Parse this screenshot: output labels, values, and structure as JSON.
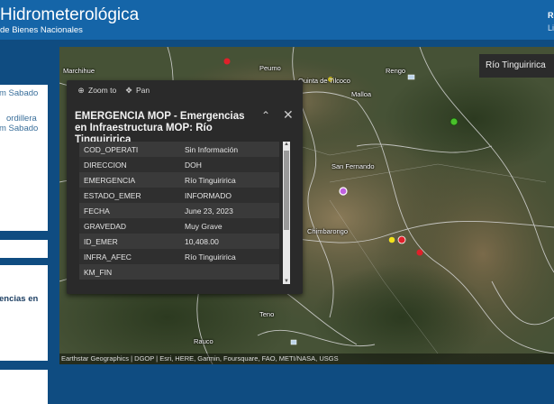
{
  "header": {
    "title": "Hidrometerológica",
    "subtitle": "de Bienes Nacionales",
    "right_top": "Re",
    "right_bottom": "Li"
  },
  "sidebar": {
    "card1_line1": "m Sabado",
    "card1_line2": "ordillera",
    "card1_line3": "m Sabado",
    "card3_line": "encias en"
  },
  "map": {
    "layer_label": "Río Tinguiririca",
    "places": [
      "Marchihue",
      "Peumo",
      "Quinta de Tilcoco",
      "Rengo",
      "Malloa",
      "San Fernando",
      "Chimbarongo",
      "Teno",
      "Rauco"
    ],
    "attribution": "Earthstar Geographics | DGOP | Esri, HERE, Garmin, Foursquare, FAO, METI/NASA, USGS"
  },
  "popup": {
    "zoom_label": "Zoom to",
    "pan_label": "Pan",
    "title": "EMERGENCIA MOP - Emergencias en Infraestructura MOP: Río Tinguiririca",
    "attributes": [
      {
        "key": "COD_OPERATI",
        "value": "Sin Información"
      },
      {
        "key": "DIRECCION",
        "value": "DOH"
      },
      {
        "key": "EMERGENCIA",
        "value": "Río Tinguiririca"
      },
      {
        "key": "ESTADO_EMER",
        "value": "INFORMADO"
      },
      {
        "key": "FECHA",
        "value": "June 23, 2023"
      },
      {
        "key": "GRAVEDAD",
        "value": "Muy Grave"
      },
      {
        "key": "ID_EMER",
        "value": "10,408.00"
      },
      {
        "key": "INFRA_AFEC",
        "value": "Río Tinguiririca"
      },
      {
        "key": "KM_FIN",
        "value": ""
      }
    ]
  },
  "colors": {
    "header_bg": "#1565a8",
    "frame_bg": "#0f4c81",
    "popup_bg": "#2a2a2a",
    "marker_red": "#e0202a",
    "marker_yellow": "#f2e21a",
    "marker_green": "#49c12a",
    "marker_purple": "#c060e0"
  }
}
